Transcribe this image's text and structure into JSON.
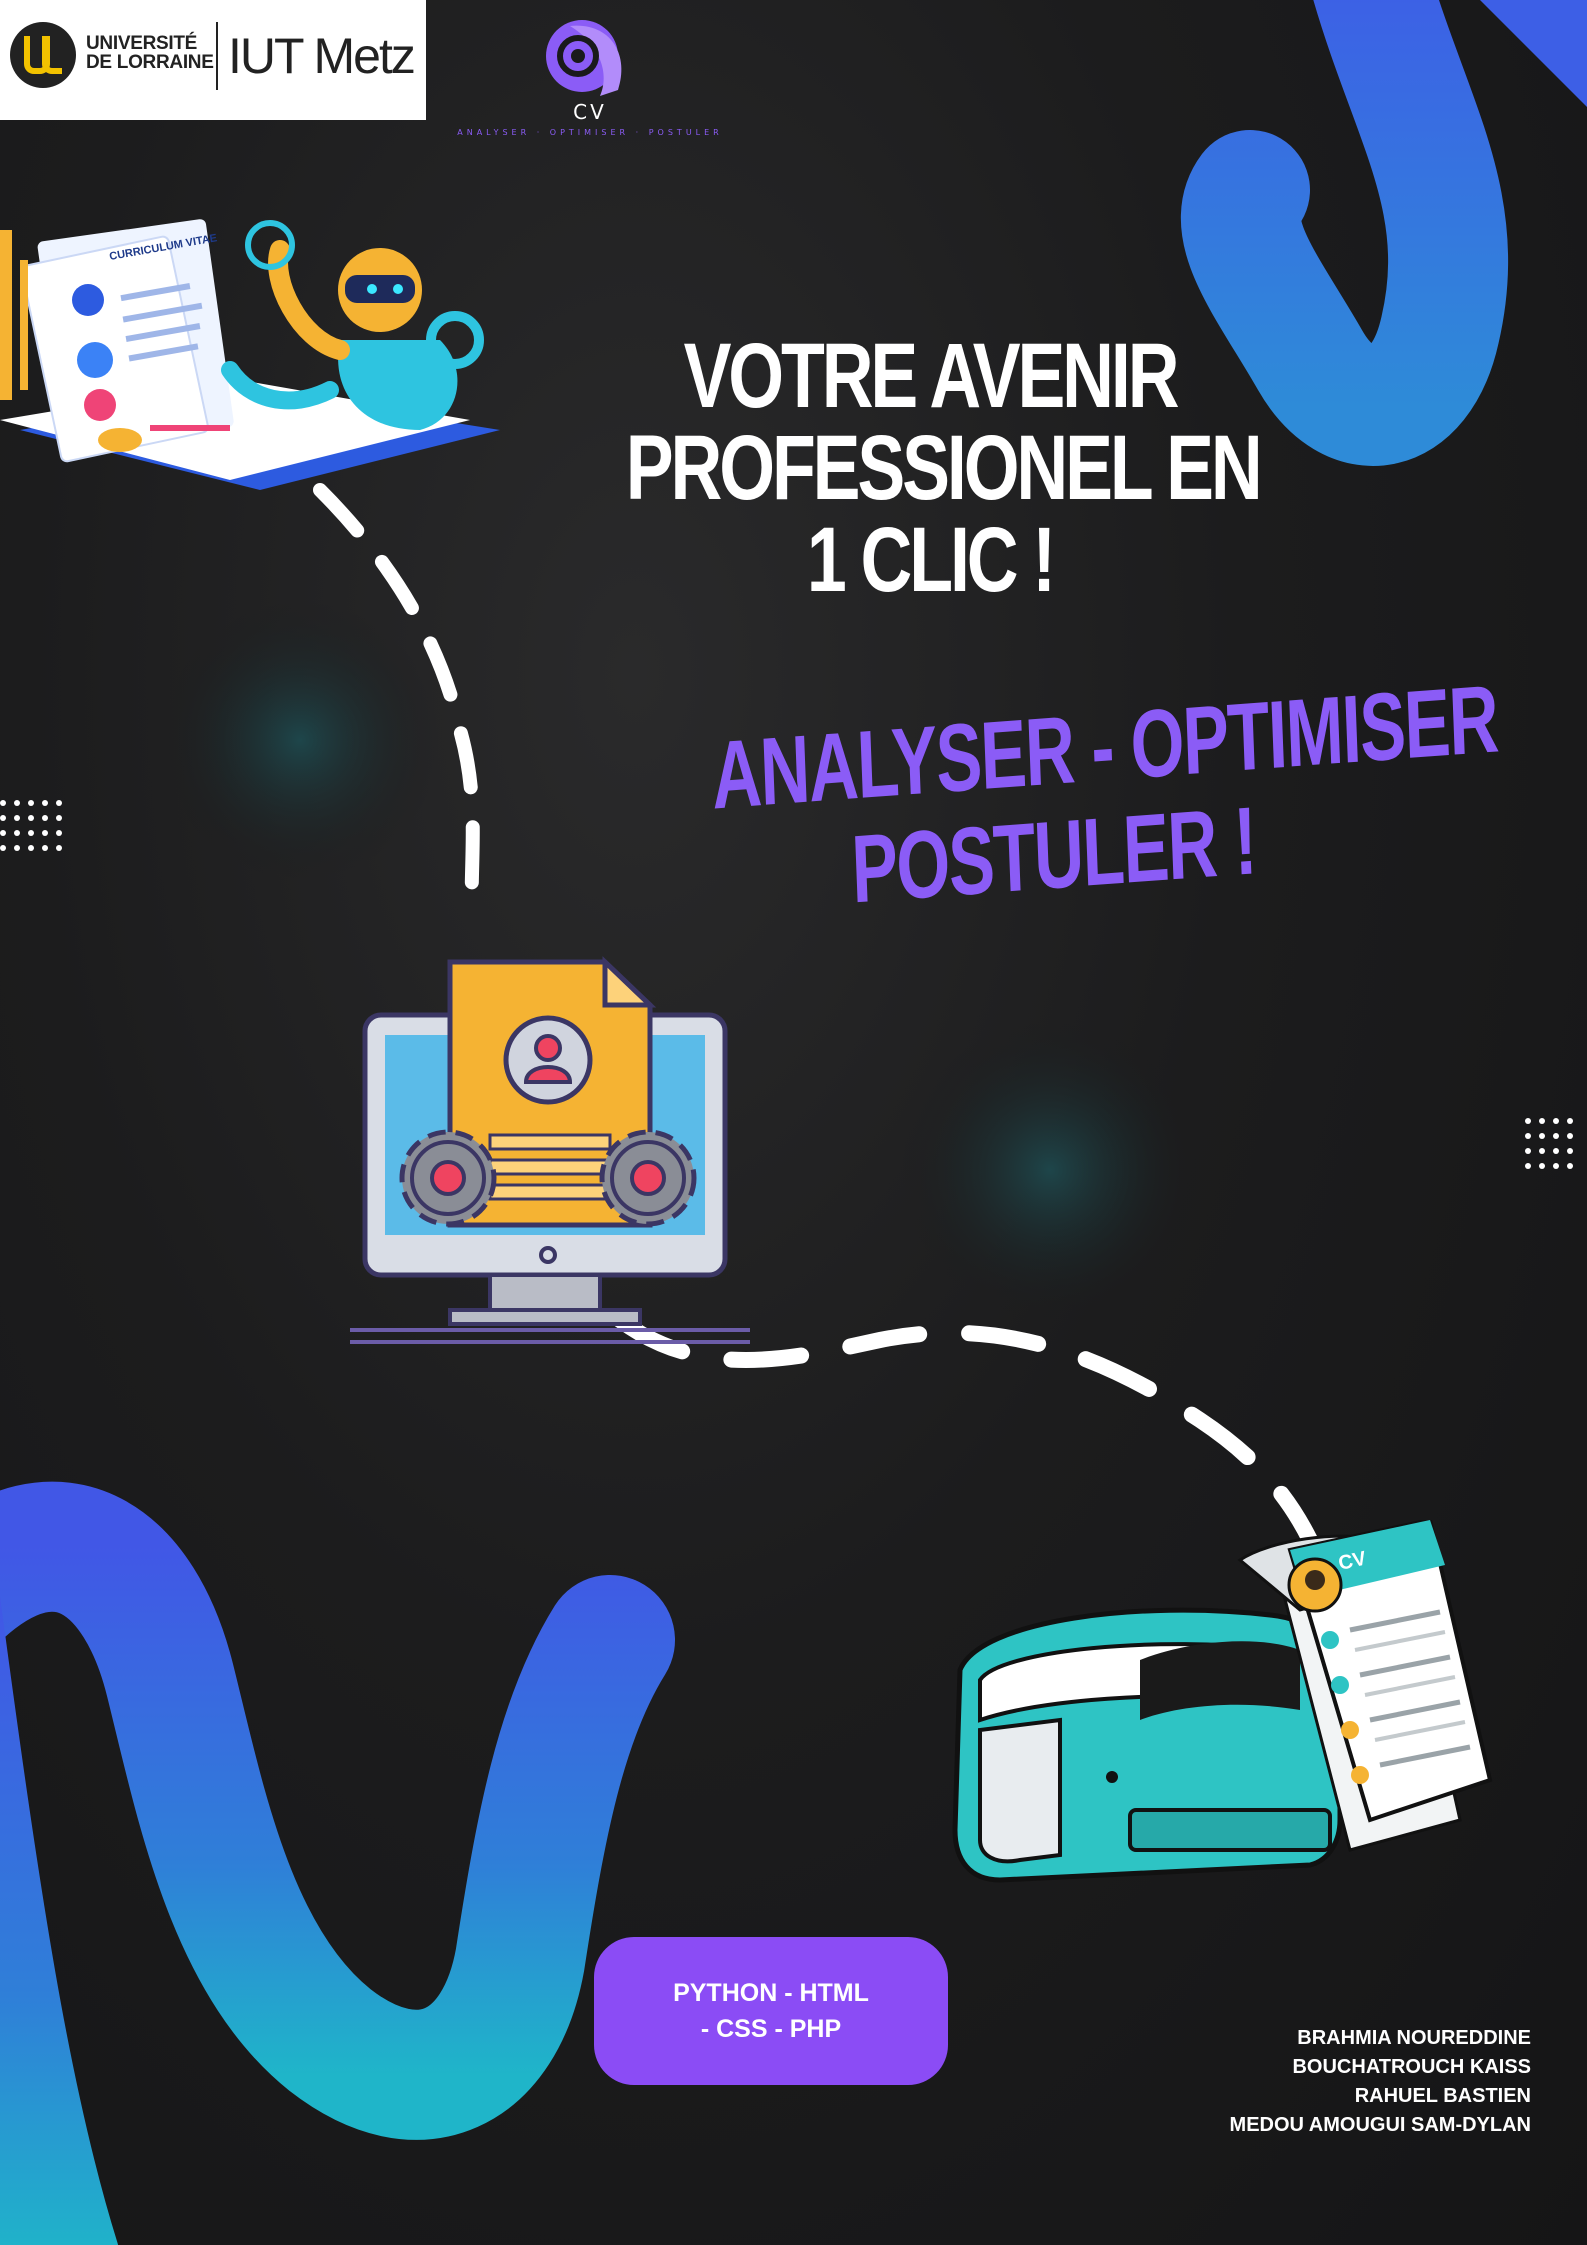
{
  "header": {
    "university_name_line1": "UNIVERSITÉ",
    "university_name_line2": "DE LORRAINE",
    "iut_name": "IUT Metz",
    "app_logo_label": "CV",
    "app_logo_tagline": "ANALYSER · OPTIMISER · POSTULER"
  },
  "headline": {
    "line1": "VOTRE AVENIR",
    "line2": "PROFESSIONEL EN",
    "line3": "1 CLIC !"
  },
  "tagline": {
    "line1": "ANALYSER  -  OPTIMISER",
    "line2": "POSTULER  !"
  },
  "illustrations": {
    "top_left_resume_title": "CURRICULUM VITAE",
    "printer_document_label": "CV"
  },
  "tech": {
    "line1": "PYTHON - HTML",
    "line2": "- CSS - PHP"
  },
  "authors": [
    "BRAHMIA NOUREDDINE",
    "BOUCHATROUCH KAISS",
    "RAHUEL BASTIEN",
    "MEDOU AMOUGUI SAM-DYLAN"
  ],
  "colors": {
    "background": "#1a1a1b",
    "accent_purple": "#8b5cf6",
    "blue_stroke": "#3b5ee8",
    "printer_teal": "#2ec4c4",
    "folder_orange": "#f5b333"
  },
  "icons": [
    "university-logo",
    "app-logo-icon",
    "robot-resume-illustration",
    "computer-document-icon",
    "printer-cv-illustration"
  ]
}
